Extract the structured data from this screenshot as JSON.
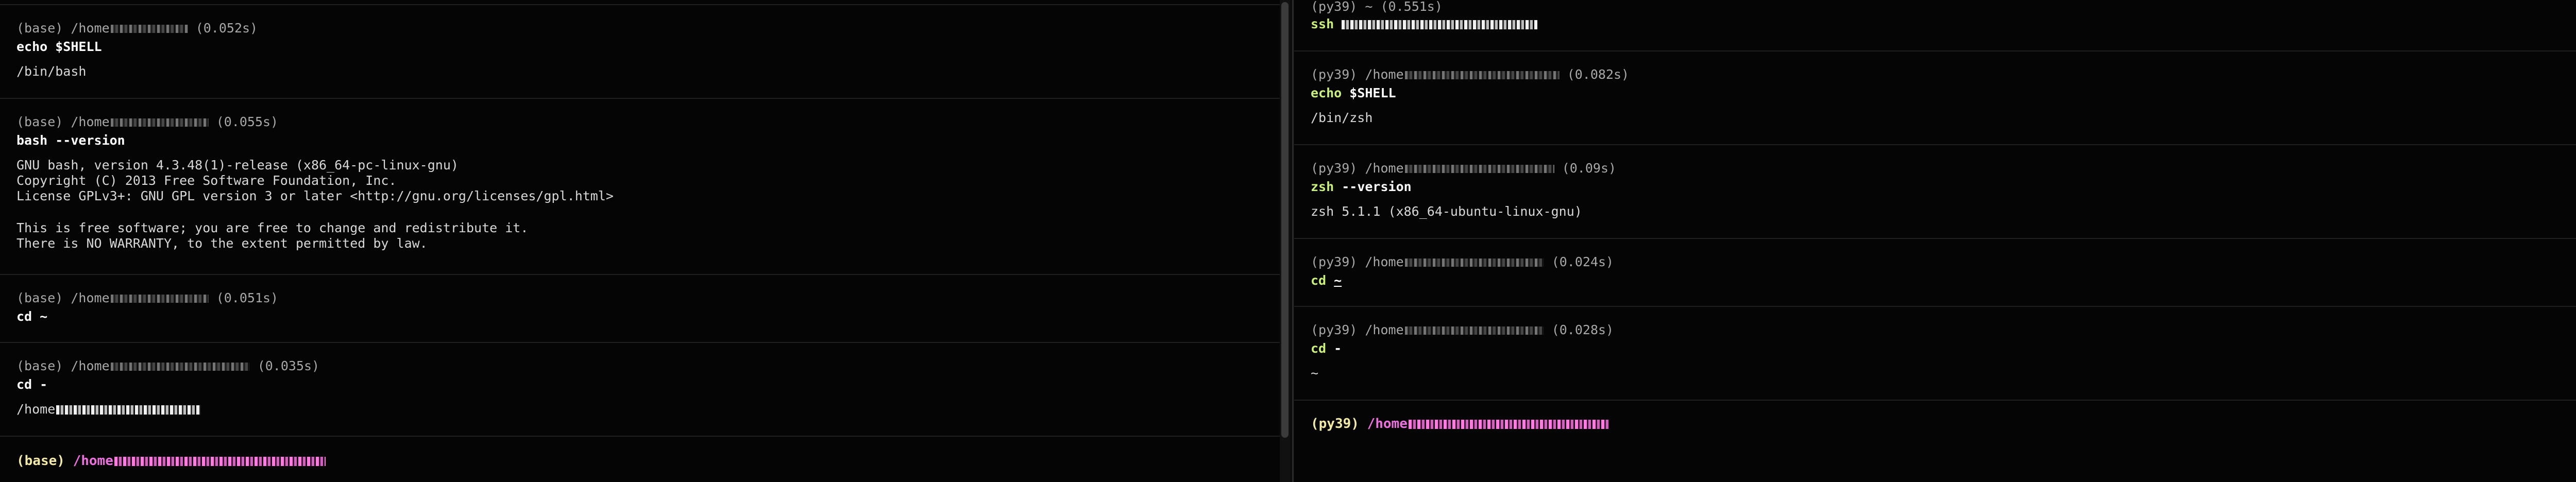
{
  "left": {
    "blocks": [
      {
        "meta_prefix": "(base) /home",
        "meta_time": "(0.052s)",
        "command": "echo $SHELL",
        "output": [
          "/bin/bash"
        ]
      },
      {
        "meta_prefix": "(base) /home",
        "meta_time": "(0.055s)",
        "command": "bash --version",
        "output": [
          "GNU bash, version 4.3.48(1)-release (x86_64-pc-linux-gnu)",
          "Copyright (C) 2013 Free Software Foundation, Inc.",
          "License GPLv3+: GNU GPL version 3 or later <http://gnu.org/licenses/gpl.html>",
          "",
          "This is free software; you are free to change and redistribute it.",
          "There is NO WARRANTY, to the extent permitted by law."
        ]
      },
      {
        "meta_prefix": "(base) /home",
        "meta_time": "(0.051s)",
        "command": "cd ~",
        "output": []
      },
      {
        "meta_prefix": "(base) /home",
        "meta_time": "(0.035s)",
        "command": "cd -",
        "output": [
          "/home"
        ]
      }
    ],
    "active_prompt": {
      "env": "(base)",
      "path": "/home"
    }
  },
  "right": {
    "blocks": [
      {
        "meta_prefix": "(py39) ~",
        "meta_time": "(0.551s)",
        "command": "ssh",
        "output": []
      },
      {
        "meta_prefix": "(py39) /home",
        "meta_time": "(0.082s)",
        "command": "echo",
        "command_arg": "$SHELL",
        "output": [
          "/bin/zsh"
        ]
      },
      {
        "meta_prefix": "(py39) /home",
        "meta_time": "(0.09s)",
        "command": "zsh",
        "command_arg": "--version",
        "output": [
          "zsh 5.1.1 (x86_64-ubuntu-linux-gnu)"
        ]
      },
      {
        "meta_prefix": "(py39) /home",
        "meta_time": "(0.024s)",
        "command": "cd",
        "command_arg": "~",
        "output": []
      },
      {
        "meta_prefix": "(py39) /home",
        "meta_time": "(0.028s)",
        "command": "cd",
        "command_arg": "-",
        "output": [
          "~"
        ]
      }
    ],
    "active_prompt": {
      "env": "(py39)",
      "path": "/home"
    }
  }
}
